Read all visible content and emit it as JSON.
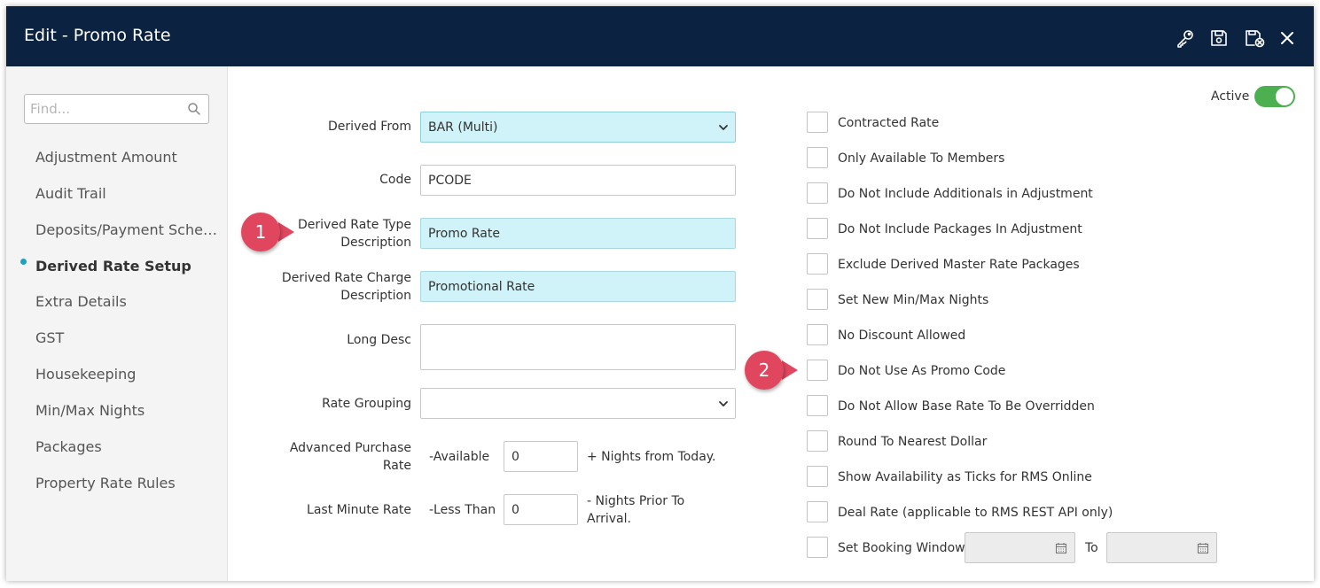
{
  "window": {
    "title": "Edit - Promo Rate"
  },
  "toolbar": {
    "icons": [
      "key-icon",
      "save-icon",
      "save-close-icon",
      "close-icon"
    ]
  },
  "sidebar": {
    "search_placeholder": "Find...",
    "items": [
      {
        "label": "Adjustment Amount",
        "active": false
      },
      {
        "label": "Audit Trail",
        "active": false
      },
      {
        "label": "Deposits/Payment Schedule",
        "active": false
      },
      {
        "label": "Derived Rate Setup",
        "active": true
      },
      {
        "label": "Extra Details",
        "active": false
      },
      {
        "label": "GST",
        "active": false
      },
      {
        "label": "Housekeeping",
        "active": false
      },
      {
        "label": "Min/Max Nights",
        "active": false
      },
      {
        "label": "Packages",
        "active": false
      },
      {
        "label": "Property Rate Rules",
        "active": false
      }
    ]
  },
  "form": {
    "derived_from": {
      "label": "Derived From",
      "value": "BAR (Multi)"
    },
    "code": {
      "label": "Code",
      "value": "PCODE"
    },
    "type_desc": {
      "label_line1": "Derived Rate Type",
      "label_line2": "Description",
      "value": "Promo Rate"
    },
    "charge_desc": {
      "label_line1": "Derived Rate Charge",
      "label_line2": "Description",
      "value": "Promotional Rate"
    },
    "long_desc": {
      "label": "Long Desc",
      "value": ""
    },
    "rate_grouping": {
      "label": "Rate Grouping",
      "value": ""
    },
    "advanced_purchase": {
      "label_line1": "Advanced Purchase",
      "label_line2": "Rate",
      "prefix": "-Available",
      "value": "0",
      "suffix": "+ Nights from Today."
    },
    "last_minute": {
      "label": "Last Minute Rate",
      "prefix": "-Less Than",
      "value": "0",
      "suffix_line1": "- Nights Prior To",
      "suffix_line2": "Arrival."
    }
  },
  "active": {
    "label": "Active",
    "on": true
  },
  "options": [
    {
      "label": "Contracted Rate",
      "checked": false
    },
    {
      "label": "Only Available To Members",
      "checked": false
    },
    {
      "label": "Do Not Include Additionals in Adjustment",
      "checked": false
    },
    {
      "label": "Do Not Include Packages In Adjustment",
      "checked": false
    },
    {
      "label": "Exclude Derived Master Rate Packages",
      "checked": false
    },
    {
      "label": "Set New Min/Max Nights",
      "checked": false
    },
    {
      "label": "No Discount Allowed",
      "checked": false
    },
    {
      "label": "Do Not Use As Promo Code",
      "checked": false
    },
    {
      "label": "Do Not Allow Base Rate To Be Overridden",
      "checked": false
    },
    {
      "label": "Round To Nearest Dollar",
      "checked": false
    },
    {
      "label": "Show Availability as Ticks for RMS Online",
      "checked": false
    },
    {
      "label": "Deal Rate (applicable to RMS REST API only)",
      "checked": false
    },
    {
      "label": "Set Booking Window",
      "checked": false
    }
  ],
  "booking_window": {
    "to_label": "To",
    "from_value": "",
    "to_value": ""
  },
  "annotations": {
    "badge1": "1",
    "badge2": "2"
  },
  "colors": {
    "titlebar": "#0b2240",
    "highlight_field": "#cff3f8",
    "toggle_on": "#4caf50",
    "badge": "#e0475f",
    "active_dot": "#17a3c4"
  }
}
